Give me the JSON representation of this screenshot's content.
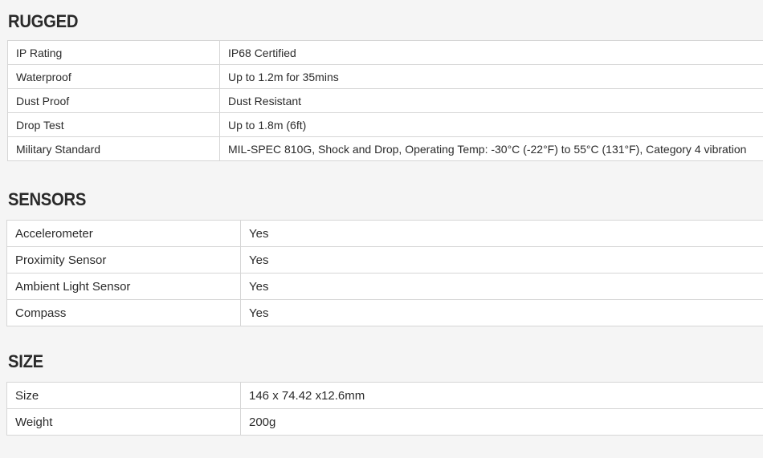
{
  "rugged": {
    "title": "RUGGED",
    "rows": [
      {
        "label": "IP Rating",
        "value": "IP68 Certified"
      },
      {
        "label": "Waterproof",
        "value": "Up to 1.2m for 35mins"
      },
      {
        "label": "Dust Proof",
        "value": "Dust Resistant"
      },
      {
        "label": "Drop Test",
        "value": "Up to 1.8m (6ft)"
      },
      {
        "label": "Military Standard",
        "value": "MIL-SPEC 810G, Shock and Drop, Operating Temp: -30°C (-22°F) to 55°C (131°F), Category 4 vibration"
      }
    ]
  },
  "sensors": {
    "title": "SENSORS",
    "rows": [
      {
        "label": "Accelerometer",
        "value": "Yes"
      },
      {
        "label": "Proximity Sensor",
        "value": "Yes"
      },
      {
        "label": "Ambient Light Sensor",
        "value": "Yes"
      },
      {
        "label": "Compass",
        "value": "Yes"
      }
    ]
  },
  "size": {
    "title": "SIZE",
    "rows": [
      {
        "label": "Size",
        "value": "146 x 74.42 x12.6mm"
      },
      {
        "label": "Weight",
        "value": "200g"
      }
    ]
  }
}
